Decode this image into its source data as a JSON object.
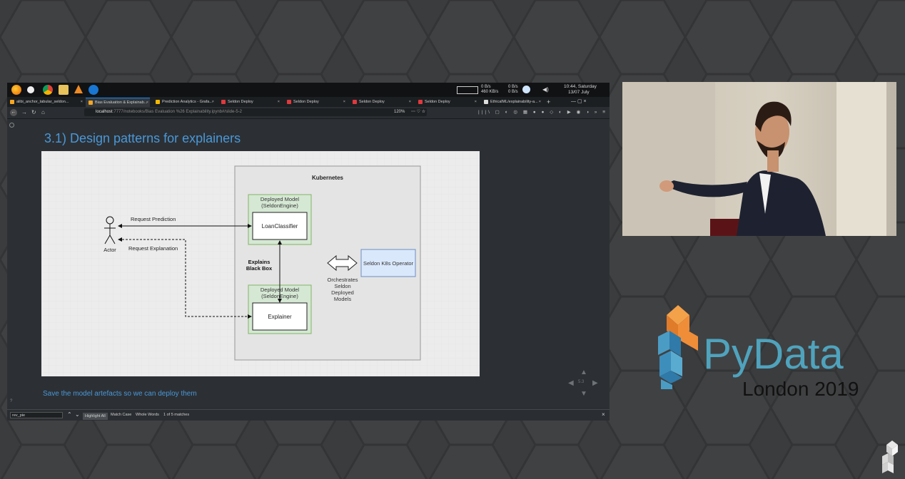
{
  "taskbar": {
    "network_up": "0 B/s",
    "network_down": "460 KB/s",
    "disk_read": "0 B/s",
    "disk_write": "0 B/s",
    "time": "10:44, Saturday",
    "date": "13/07 July"
  },
  "tabs": [
    {
      "label": "alibi_anchor_tabular_seldon...",
      "active": false,
      "favicon_color": "#f5a623"
    },
    {
      "label": "Bias Evaluation & Explainab...",
      "active": true,
      "favicon_color": "#f5a623"
    },
    {
      "label": "Prediction Analytics - Grafa...",
      "active": false,
      "favicon_color": "#f5b800"
    },
    {
      "label": "Seldon Deploy",
      "active": false,
      "favicon_color": "#e0393e"
    },
    {
      "label": "Seldon Deploy",
      "active": false,
      "favicon_color": "#e0393e"
    },
    {
      "label": "Seldon Deploy",
      "active": false,
      "favicon_color": "#e0393e"
    },
    {
      "label": "Seldon Deploy",
      "active": false,
      "favicon_color": "#e0393e"
    },
    {
      "label": "EthicalML/explainability-a...",
      "active": false,
      "favicon_color": "#dddddd"
    }
  ],
  "new_tab_label": "+",
  "url": {
    "host": "localhost",
    "path": ":7777/notebooks/Bias Evaluation %26 Explainability.ipynb#/slide-5-2",
    "zoom": "120%"
  },
  "slide": {
    "title": "3.1) Design patterns for explainers",
    "caption": "Save the model artefacts so we can deploy them",
    "page_indicator": "5.3"
  },
  "diagram": {
    "cluster_label": "Kubernetes",
    "deployed_model_1": "Deployed Model\n(SeldonEngine)",
    "loan_classifier": "LoanClassifier",
    "deployed_model_2": "Deployed Model\n(SeldonEngine)",
    "explainer": "Explainer",
    "actor": "Actor",
    "request_prediction": "Request Prediction",
    "request_explanation": "Request Explanation",
    "explains_black_box": "Explains\nBlack Box",
    "orchestrates": "Orchestrates\nSeldon\nDeployed\nModels",
    "operator": "Seldon K8s Operator"
  },
  "findbar": {
    "search_value": "rev_pie",
    "highlight_all": "Highlight All",
    "match_case": "Match Case",
    "whole_words": "Whole Words",
    "matches": "1 of 5 matches",
    "close": "×"
  },
  "branding": {
    "pydata": "PyData",
    "event": "London 2019",
    "colors": {
      "pydata_blue": "#4fa3bd",
      "cube_orange": "#f08d38",
      "cube_blue": "#4b9cc4"
    }
  },
  "colors": {
    "slide_title": "#4a97d8",
    "diagram_model_fill": "#d5e8d4",
    "diagram_model_border": "#82b366",
    "operator_fill": "#dae8fc",
    "operator_border": "#6c8ebf"
  }
}
